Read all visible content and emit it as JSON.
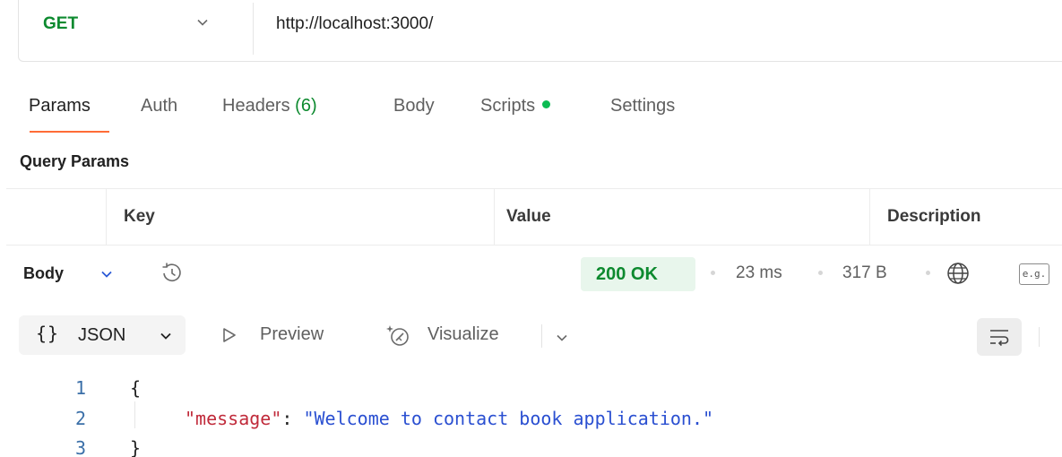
{
  "request": {
    "method": "GET",
    "url": "http://localhost:3000/"
  },
  "tabs": [
    {
      "label": "Params",
      "active": true
    },
    {
      "label": "Auth"
    },
    {
      "label": "Headers",
      "count": "(6)"
    },
    {
      "label": "Body"
    },
    {
      "label": "Scripts",
      "has_indicator": true
    },
    {
      "label": "Settings"
    }
  ],
  "query_params": {
    "title": "Query Params",
    "columns": [
      "Key",
      "Value",
      "Description"
    ]
  },
  "response": {
    "label": "Body",
    "status": "200 OK",
    "time": "23 ms",
    "size": "317 B",
    "example_badge": "e.g."
  },
  "response_toolbar": {
    "braces": "{}",
    "format": "JSON",
    "preview": "Preview",
    "visualize": "Visualize"
  },
  "code": {
    "line_numbers": [
      "1",
      "2",
      "3"
    ],
    "open": "{",
    "key": "\"message\"",
    "colon": ": ",
    "value": "\"Welcome to contact book application.\"",
    "close": "}"
  },
  "colors": {
    "accent": "#ff6c37",
    "status_ok": "#0d8a2f",
    "json_key": "#c02a3a",
    "json_string": "#2a4fd1"
  }
}
